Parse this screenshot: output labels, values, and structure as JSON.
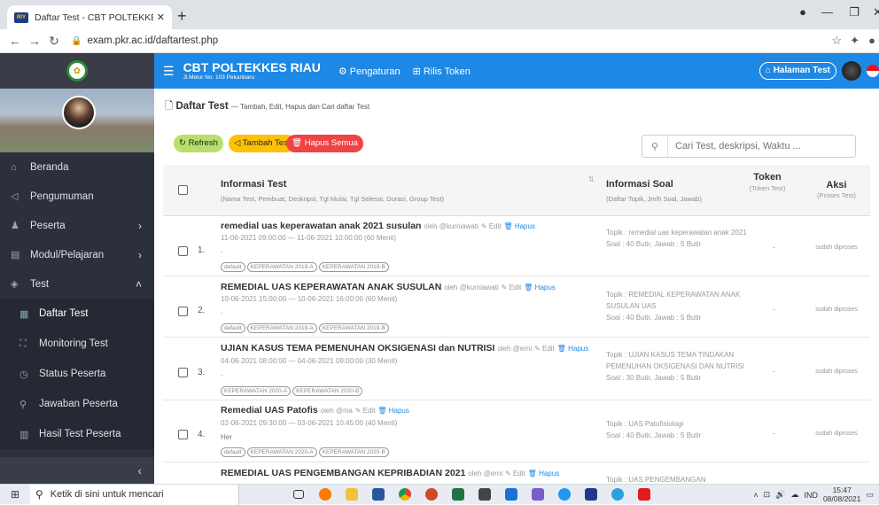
{
  "browser": {
    "tab_title": "Daftar Test - CBT POLTEKKES RIAU",
    "favicon_text": "RIY",
    "url": "exam.pkr.ac.id/daftartest.php"
  },
  "header": {
    "brand_title": "CBT POLTEKKES RIAU",
    "brand_subtitle": "Jl.Melur No. 103 Pekanbaru",
    "nav_pengaturan": "Pengaturan",
    "nav_rilis_token": "Rilis Token",
    "halaman_test": "Halaman Test"
  },
  "sidebar": {
    "items": [
      {
        "label": "Beranda",
        "icon": "home-icon"
      },
      {
        "label": "Pengumuman",
        "icon": "send-icon"
      },
      {
        "label": "Peserta",
        "icon": "users-icon"
      },
      {
        "label": "Modul/Pelajaran",
        "icon": "book-icon"
      },
      {
        "label": "Test",
        "icon": "layers-icon"
      },
      {
        "label": "Daftar Test",
        "icon": "calendar-icon"
      },
      {
        "label": "Monitoring Test",
        "icon": "monitor-icon"
      },
      {
        "label": "Status Peserta",
        "icon": "status-icon"
      },
      {
        "label": "Jawaban Peserta",
        "icon": "answer-icon"
      },
      {
        "label": "Hasil Test Peserta",
        "icon": "chart-icon"
      }
    ]
  },
  "page": {
    "title": "Daftar Test",
    "subtitle": "— Tambah, Edit, Hapus dan Cari daftar Test",
    "btn_refresh": "Refresh",
    "btn_tambah": "Tambah Test",
    "btn_hapus_semua": "Hapus Semua",
    "search_placeholder": "Cari Test, deskripsi, Waktu ..."
  },
  "table": {
    "col1_title": "Informasi Test",
    "col1_sub": "(Nama Test, Pembuat, Deskripsi, Tgl Mulai, Tgl Selesai, Durasi, Group Test)",
    "col2_title": "Informasi Soal",
    "col2_sub": "(Daftar Topik, Jmlh Soal, Jawab)",
    "col3_title": "Token",
    "col3_sub": "(Token Test)",
    "col4_title": "Aksi",
    "col4_sub": "(Proses Test)",
    "rows": [
      {
        "num": "1.",
        "title": "remedial uas keperawatan anak 2021 susulan",
        "author": "oleh @kurniawati",
        "edit": "Edit",
        "hapus": "Hapus",
        "when": "11-06-2021 09:00:00 — 11-06-2021 10:00:00 (60 Menit)",
        "desc": "-",
        "tags": [
          "default",
          "KEPERAWATAN 2019-A",
          "KEPERAWATAN 2019-B"
        ],
        "topik": "Topik : remedial uas keperawatan anak 2021",
        "soal": "Soal : 40 Butir, Jawab : 5 Butir",
        "token": "-",
        "aksi": "sudah diproses"
      },
      {
        "num": "2.",
        "title": "REMEDIAL UAS KEPERAWATAN ANAK SUSULAN",
        "author": "oleh @kurniawati",
        "edit": "Edit",
        "hapus": "Hapus",
        "when": "10-06-2021 15:00:00 — 10-06-2021 16:00:00 (60 Menit)",
        "desc": "-",
        "tags": [
          "default",
          "KEPERAWATAN 2019-A",
          "KEPERAWATAN 2019-B"
        ],
        "topik": "Topik : REMEDIAL KEPERAWATAN ANAK SUSULAN UAS",
        "soal": "Soal : 40 Butir, Jawab : 5 Butir",
        "token": "-",
        "aksi": "sudah diproses"
      },
      {
        "num": "3.",
        "title": "UJIAN KASUS TEMA PEMENUHAN OKSIGENASI dan NUTRISI",
        "author": "oleh @erni",
        "edit": "Edit",
        "hapus": "Hapus",
        "when": "04-06-2021 08:00:00 — 04-06-2021 09:00:00 (30 Menit)",
        "desc": "-",
        "tags": [
          "KEPERAWATAN 2020-A",
          "KEPERAWATAN 2020-B"
        ],
        "topik": "Topik : UJIAN KASUS TEMA TINDAKAN PEMENUHAN OKSIGENASI DAN NUTRISI",
        "soal": "Soal : 30 Butir, Jawab : 5 Butir",
        "token": "-",
        "aksi": "sudah diproses"
      },
      {
        "num": "4.",
        "title": "Remedial UAS Patofis",
        "author": "oleh @nia",
        "edit": "Edit",
        "hapus": "Hapus",
        "when": "02-06-2021 09:30:00 — 03-06-2021 10:45:00 (40 Menit)",
        "desc": "Her",
        "tags": [
          "default",
          "KEPERAWATAN 2020-A",
          "KEPERAWATAN 2020-B"
        ],
        "topik": "Topik : UAS Patofisiologi",
        "soal": "Soal : 40 Butir, Jawab : 5 Butir",
        "token": "-",
        "aksi": "sudah diproses"
      },
      {
        "num": "",
        "title": "REMEDIAL UAS PENGEMBANGAN KEPRIBADIAN 2021",
        "author": "oleh @erni",
        "edit": "Edit",
        "hapus": "Hapus",
        "topik": "Topik : UAS PENGEMBANGAN"
      }
    ]
  },
  "taskbar": {
    "search_text": "Ketik di sini untuk mencari",
    "lang": "IND",
    "time": "15:47",
    "date": "08/08/2021"
  }
}
